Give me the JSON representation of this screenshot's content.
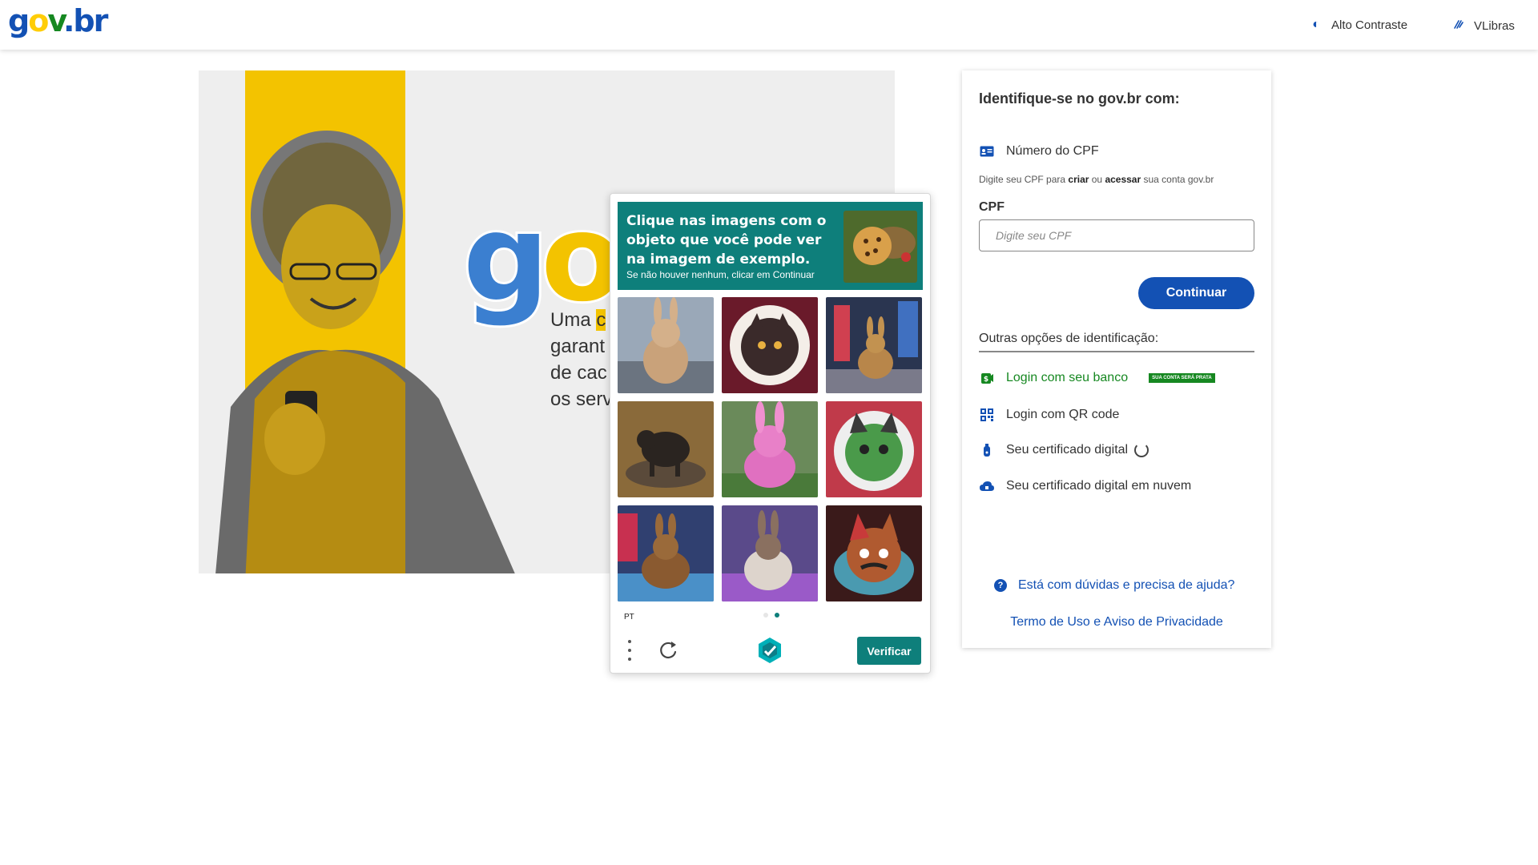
{
  "header": {
    "logo": {
      "g": "g",
      "o": "o",
      "v": "v",
      "dot": ".",
      "br": "br"
    },
    "contrast_label": "Alto Contraste",
    "vlibras_label": "VLibras"
  },
  "banner": {
    "big_logo": {
      "g": "g",
      "o": "o"
    },
    "tagline": [
      "Uma",
      "garant",
      "de cac",
      "os serv"
    ],
    "tagline_highlight": "c"
  },
  "captcha": {
    "title": "Clique nas imagens com o objeto que você pode ver na imagem de exemplo.",
    "subtitle": "Se não houver nenhum, clicar em Continuar",
    "language": "PT",
    "verify_label": "Verificar",
    "tiles": [
      {
        "subject": "rabbit"
      },
      {
        "subject": "cat-plate"
      },
      {
        "subject": "rabbit"
      },
      {
        "subject": "dog"
      },
      {
        "subject": "rabbit-pink"
      },
      {
        "subject": "cat-plate"
      },
      {
        "subject": "rabbit"
      },
      {
        "subject": "rabbit"
      },
      {
        "subject": "cat-plate"
      }
    ],
    "accent_color": "#0e7f7b"
  },
  "login": {
    "title": "Identifique-se no gov.br com:",
    "cpf_option": "Número do CPF",
    "hint": {
      "pre": "Digite seu CPF para ",
      "b1": "criar",
      "mid": " ou ",
      "b2": "acessar",
      "post": " sua conta gov.br"
    },
    "cpf_label": "CPF",
    "cpf_placeholder": "Digite seu CPF",
    "continue_label": "Continuar",
    "other_title": "Outras opções de identificação:",
    "options": {
      "bank": "Login com seu banco",
      "bank_badge": "SUA CONTA SERÁ PRATA",
      "qr": "Login com QR code",
      "cert": "Seu certificado digital",
      "cloud_cert": "Seu certificado digital em nuvem"
    },
    "help": "Está com dúvidas e precisa de ajuda?",
    "terms": "Termo de Uso e Aviso de Privacidade"
  },
  "colors": {
    "primary": "#1351b4",
    "green": "#168821",
    "yellow": "#ffcd07"
  }
}
